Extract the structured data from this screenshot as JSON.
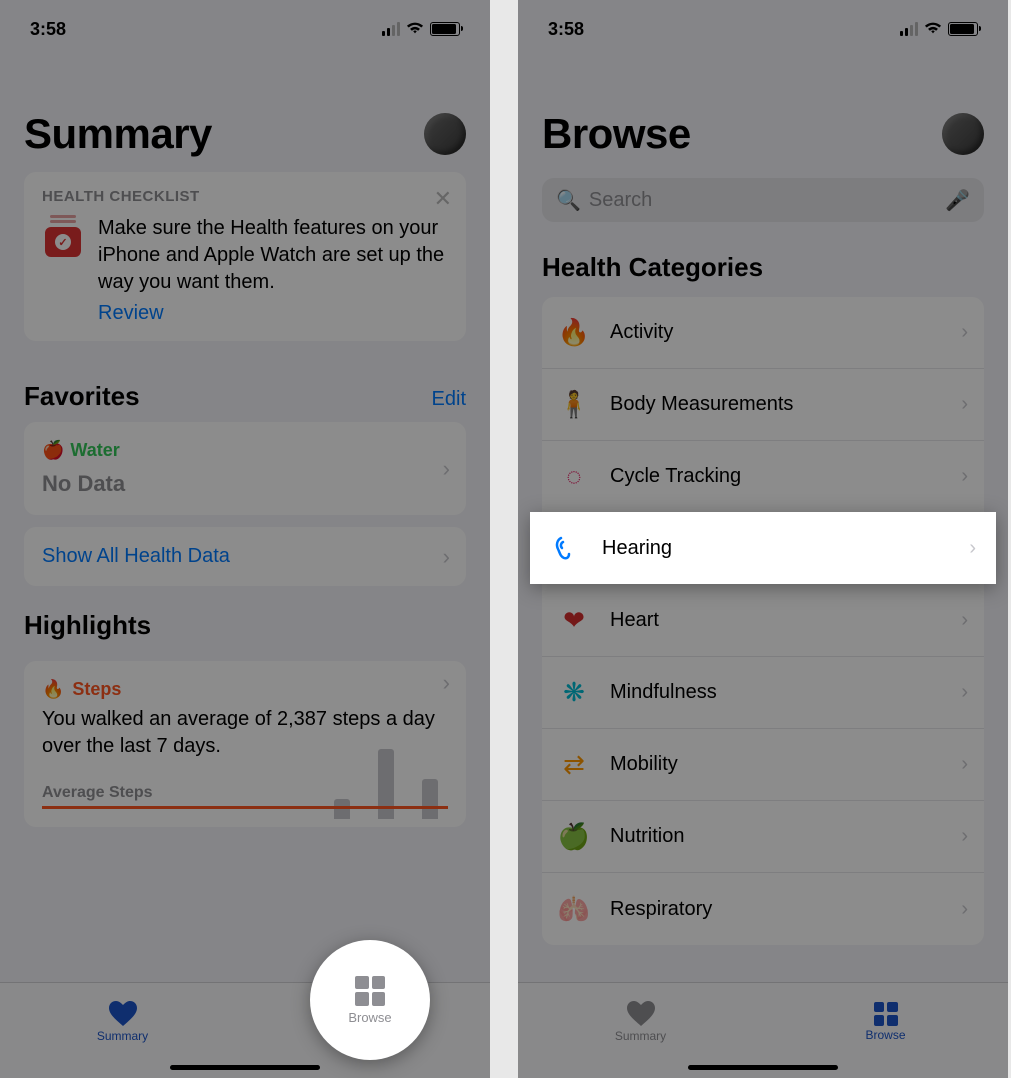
{
  "status": {
    "time": "3:58"
  },
  "left": {
    "title": "Summary",
    "checklist": {
      "header": "HEALTH CHECKLIST",
      "body": "Make sure the Health features on your iPhone and Apple Watch are set up the way you want them.",
      "review": "Review"
    },
    "favorites": {
      "header": "Favorites",
      "edit": "Edit",
      "water": "Water",
      "nodata": "No Data"
    },
    "show_all": "Show All Health Data",
    "highlights": {
      "header": "Highlights",
      "steps_label": "Steps",
      "desc": "You walked an average of 2,387 steps a day over the last 7 days.",
      "avg_label": "Average Steps"
    },
    "tabs": {
      "summary": "Summary",
      "browse": "Browse"
    }
  },
  "right": {
    "title": "Browse",
    "search": "Search",
    "category_header": "Health Categories",
    "categories": {
      "activity": "Activity",
      "body": "Body Measurements",
      "cycle": "Cycle Tracking",
      "hearing": "Hearing",
      "heart": "Heart",
      "mind": "Mindfulness",
      "mobility": "Mobility",
      "nutrition": "Nutrition",
      "respiratory": "Respiratory"
    },
    "tabs": {
      "summary": "Summary",
      "browse": "Browse"
    }
  }
}
